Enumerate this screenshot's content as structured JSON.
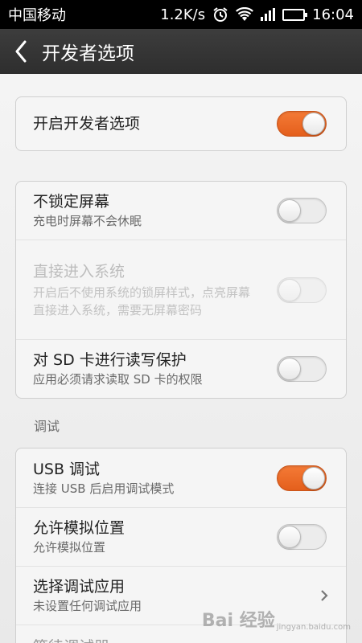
{
  "status_bar": {
    "carrier": "中国移动",
    "speed": "1.2K/s",
    "time": "16:04"
  },
  "header": {
    "title": "开发者选项"
  },
  "master": {
    "label": "开启开发者选项",
    "on": true
  },
  "security": [
    {
      "label": "不锁定屏幕",
      "sub": "充电时屏幕不会休眠",
      "on": false,
      "enabled": true
    },
    {
      "label": "直接进入系统",
      "sub": "开启后不使用系统的锁屏样式，点亮屏幕直接进入系统，需要无屏幕密码",
      "on": false,
      "enabled": false
    },
    {
      "label": "对 SD 卡进行读写保护",
      "sub": "应用必须请求读取 SD 卡的权限",
      "on": false,
      "enabled": true
    }
  ],
  "debug_section": {
    "title": "调试"
  },
  "debug": [
    {
      "label": "USB 调试",
      "sub": "连接 USB 后启用调试模式",
      "on": true,
      "type": "toggle"
    },
    {
      "label": "允许模拟位置",
      "sub": "允许模拟位置",
      "on": false,
      "type": "toggle"
    },
    {
      "label": "选择调试应用",
      "sub": "未设置任何调试应用",
      "type": "link"
    },
    {
      "label": "等待调试器",
      "type": "partial"
    }
  ],
  "watermark": {
    "text": "Bai 经验",
    "url": "jingyan.baidu.com"
  },
  "colors": {
    "accent_on": "#f06a28",
    "title_bar": "#333333"
  }
}
